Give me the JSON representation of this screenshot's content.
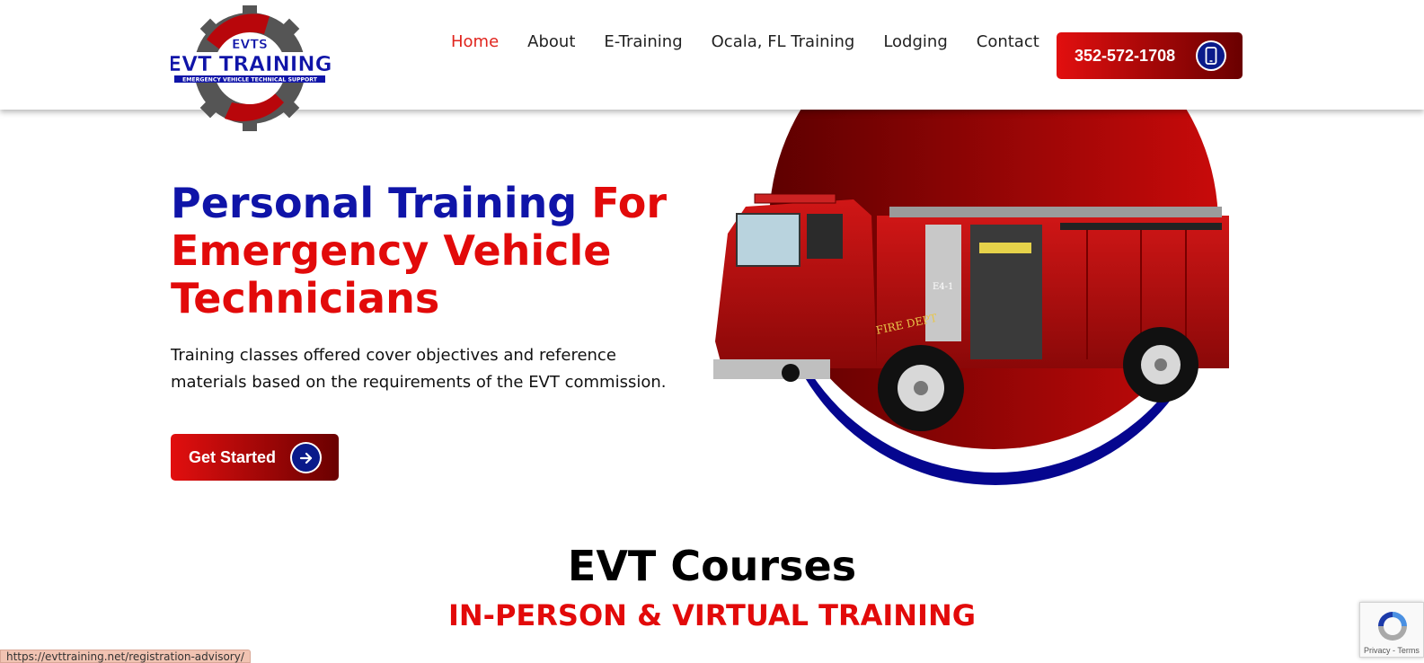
{
  "header": {
    "logo": {
      "top_text": "EVTS",
      "main_text": "EVT TRAINING",
      "tagline": "EMERGENCY VEHICLE TECHNICAL SUPPORT"
    },
    "nav": [
      {
        "label": "Home",
        "active": true
      },
      {
        "label": "About",
        "active": false
      },
      {
        "label": "E-Training",
        "active": false
      },
      {
        "label": "Ocala, FL Training",
        "active": false
      },
      {
        "label": "Lodging",
        "active": false
      },
      {
        "label": "Contact",
        "active": false
      }
    ],
    "phone_button": {
      "label": "352-572-1708",
      "icon": "mobile-phone-icon"
    }
  },
  "hero": {
    "title_part1": "Personal Training",
    "title_part2": "For",
    "title_line2": "Emergency Vehicle",
    "title_line3": "Technicians",
    "subtitle": "Training classes offered cover objectives and reference materials based on the requirements of the EVT commission.",
    "cta": {
      "label": "Get Started",
      "icon": "arrow-right-icon"
    },
    "image": {
      "description_icon": "fire-truck-icon",
      "truck_side_text": "FIRE DEPT",
      "truck_unit_text": "E4-1"
    }
  },
  "courses": {
    "title": "EVT Courses",
    "subtitle": "IN-PERSON & VIRTUAL TRAINING"
  },
  "status_bar": {
    "url": "https://evttraining.net/registration-advisory/"
  },
  "recaptcha": {
    "links": "Privacy - Terms"
  },
  "colors": {
    "brand_red": "#e20a0a",
    "brand_blue": "#0f14a8",
    "dark_red": "#6a0000",
    "nav_active": "#e0241d"
  }
}
